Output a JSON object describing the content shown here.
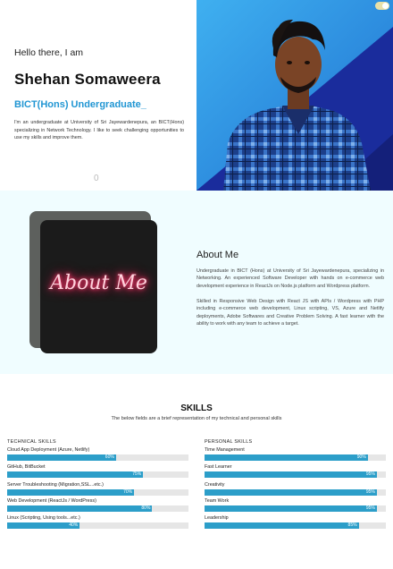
{
  "hero": {
    "greeting": "Hello there, I am",
    "name": "Shehan Somaweera",
    "role": "BICT(Hons) Undergraduate_",
    "intro": "I'm an undergraduate at University of Sri Jayewardenepura, an BICT(Hons) specializing in Network Technology. I like to seek challenging opportunities to use my skills and improve them.",
    "scroll_indicator": "0"
  },
  "about": {
    "title": "About Me",
    "neon_text": "About Me",
    "paragraph1": "Undergraduate in BICT (Hons) at University of Sri Jayewardenepura, specializing in Networking. An experienced Software Developer with hands on e-commerce web development experience in ReactJs on Node.js platform and Wordpress platform.",
    "paragraph2": "Skilled in Responsive Web Design with React JS with APIs / Wordpress with PHP including e-commerce web development, Linux scripting, VS, Azure and Netlify deployments, Adobe Softwares and Creative Problem Solving. A fast learner with the ability to work with any team to achieve a target."
  },
  "skills": {
    "title": "SKILLS",
    "subtitle": "The below fields are a brief representation of my technical and personal skills",
    "technical_title": "TECHNICAL SKILLS",
    "personal_title": "PERSONAL SKILLS",
    "technical": [
      {
        "label": "Cloud App Deployment (Azure, Netlify)",
        "value": 60,
        "pct": "60%"
      },
      {
        "label": "GitHub, BitBucket",
        "value": 75,
        "pct": "75%"
      },
      {
        "label": "Server Troubleshooting (Migration,SSL...etc.)",
        "value": 70,
        "pct": "70%"
      },
      {
        "label": "Web Development (ReactJs / WordPress)",
        "value": 80,
        "pct": "80%"
      },
      {
        "label": "Linux (Scripting, Using tools...etc.)",
        "value": 40,
        "pct": "40%"
      }
    ],
    "personal": [
      {
        "label": "Time Management",
        "value": 90,
        "pct": "90%"
      },
      {
        "label": "Fast Learner",
        "value": 95,
        "pct": "95%"
      },
      {
        "label": "Creativity",
        "value": 95,
        "pct": "95%"
      },
      {
        "label": "Team Work",
        "value": 95,
        "pct": "95%"
      },
      {
        "label": "Leadership",
        "value": 85,
        "pct": "85%"
      }
    ]
  },
  "colors": {
    "accent": "#2196d3",
    "bar_fill": "#2c9ec9",
    "bar_track": "#e6e6e6",
    "about_bg": "#f0fdff",
    "neon": "#ff2e63"
  },
  "icons": {
    "theme_toggle": "theme-toggle-icon"
  }
}
